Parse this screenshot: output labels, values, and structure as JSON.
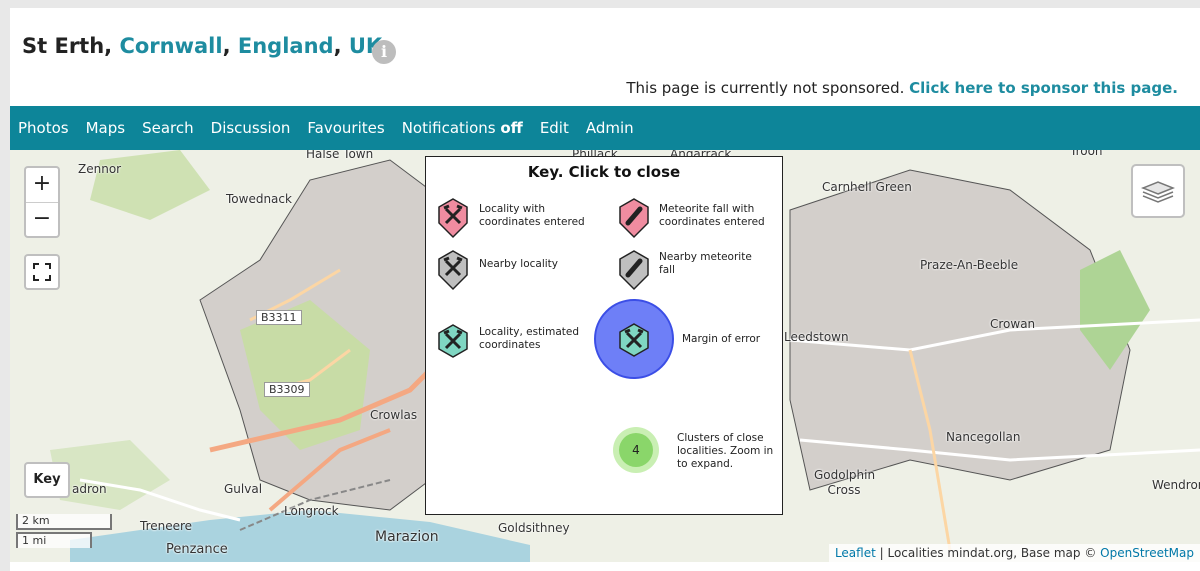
{
  "header": {
    "title_place": "St Erth",
    "sep": ", ",
    "breadcrumb": [
      "Cornwall",
      "England",
      "UK"
    ],
    "info_icon": "info-icon"
  },
  "sponsor": {
    "text": "This page is currently not sponsored. ",
    "link": "Click here to sponsor this page."
  },
  "nav": {
    "items": [
      "Photos",
      "Maps",
      "Search",
      "Discussion",
      "Favourites"
    ],
    "notifications_label": "Notifications ",
    "notifications_state": "off",
    "items_after": [
      "Edit",
      "Admin"
    ]
  },
  "map": {
    "places": [
      "Zennor",
      "Towednack",
      "Halse Town",
      "Phillack",
      "Angarrack",
      "Carnhell Green",
      "Praze-An-Beeble",
      "Crowan",
      "Leedstown",
      "Crowlas",
      "Nancegollan",
      "Godolphin Cross",
      "Wendron",
      "Gulval",
      "Longrock",
      "Treneere",
      "Penzance",
      "Marazion",
      "Goldsithney",
      "adron",
      "Troon"
    ],
    "roads": [
      "B3311",
      "B3309"
    ],
    "controls": {
      "zoom_in": "+",
      "zoom_out": "−",
      "key_button": "Key"
    },
    "scale": {
      "km": "2 km",
      "mi": "1 mi"
    },
    "attribution": {
      "leaflet": "Leaflet",
      "text": " | Localities mindat.org, Base map © ",
      "osm": "OpenStreetMap"
    }
  },
  "key_panel": {
    "title": "Key. Click to close",
    "items": {
      "locality_coords": "Locality with coordinates entered",
      "meteorite_coords": "Meteorite fall with coordinates entered",
      "nearby_locality": "Nearby locality",
      "nearby_meteorite": "Nearby meteorite fall",
      "locality_estimated": "Locality, estimated coordinates",
      "margin_error": "Margin of error",
      "clusters": "Clusters of close localities. Zoom in to expand."
    },
    "cluster_count": "4"
  },
  "colors": {
    "nav_bg": "#0d8599",
    "link": "#1e8ca0",
    "marker_pink": "#f08ca0",
    "marker_grey": "#bfbfbf",
    "marker_teal": "#7fd6c2",
    "margin_circle": "#6e7ff7",
    "cluster": "#8ad66a"
  }
}
